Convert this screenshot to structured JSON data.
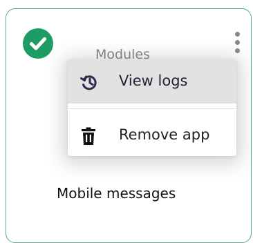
{
  "card": {
    "category": "Modules",
    "title": "Mobile messages",
    "status_icon": "check-circle-icon",
    "more_icon": "more-vertical-icon"
  },
  "menu": {
    "items": [
      {
        "label": "View logs",
        "icon": "history-icon"
      },
      {
        "label": "Remove app",
        "icon": "trash-icon"
      }
    ]
  },
  "colors": {
    "accent_green": "#1e9c66",
    "card_border": "#4fae8e",
    "menu_text": "#22223a",
    "hover_bg": "#e2e2e2"
  }
}
